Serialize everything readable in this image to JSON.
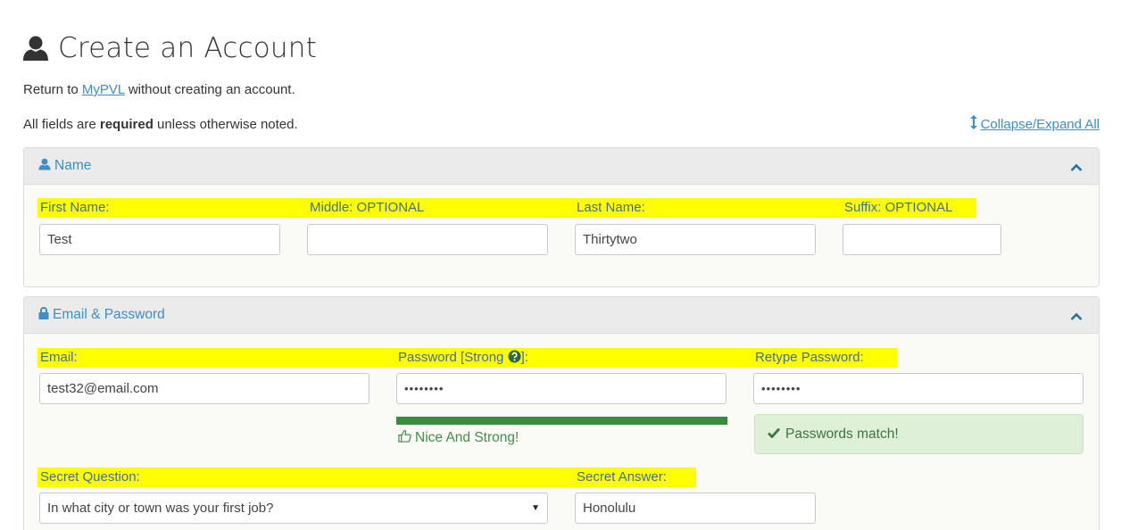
{
  "page": {
    "title": "Create an Account",
    "return_prefix": "Return to ",
    "return_link": "MyPVL",
    "return_suffix": " without creating an account.",
    "required_prefix": "All fields are ",
    "required_bold": "required",
    "required_suffix": " unless otherwise noted.",
    "collapse_expand": "Collapse/Expand All"
  },
  "name_panel": {
    "title": "Name",
    "labels": {
      "first": "First Name:",
      "middle": "Middle: OPTIONAL",
      "last": "Last Name:",
      "suffix": "Suffix: OPTIONAL"
    },
    "values": {
      "first": "Test",
      "middle": "",
      "last": "Thirtytwo",
      "suffix": ""
    }
  },
  "email_panel": {
    "title": "Email & Password",
    "labels": {
      "email": "Email:",
      "password_prefix": "Password [Strong ",
      "password_suffix": "]:",
      "retype": "Retype Password:",
      "secret_question": "Secret Question:",
      "secret_answer": "Secret Answer:"
    },
    "values": {
      "email": "test32@email.com",
      "password": "••••••••",
      "retype": "••••••••",
      "secret_question": "In what city or town was your first job?",
      "secret_answer": "Honolulu"
    },
    "strength_text": "Nice And Strong!",
    "strength_fraction": 1.0,
    "match_text": "Passwords match!"
  },
  "colors": {
    "link": "#3a8ec9",
    "highlight": "#ffff00",
    "strength_bar": "#3a8a3f",
    "success_bg": "#dff0d8",
    "success_text": "#3c763d"
  },
  "icons": {
    "title": "user-icon",
    "name_panel": "user-icon",
    "email_panel": "lock-icon",
    "collapse": "resize-vertical-icon",
    "panel_toggle": "chevron-up-icon",
    "password_help": "question-circle-icon",
    "strength": "thumbs-up-icon",
    "match": "checkmark-icon",
    "select": "caret-down-icon"
  }
}
